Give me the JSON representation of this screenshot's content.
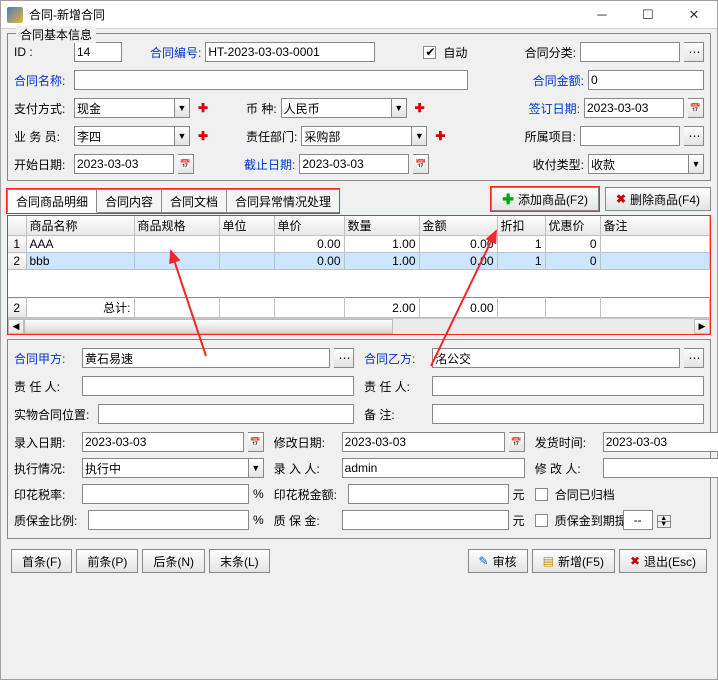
{
  "titlebar": {
    "title": "合同-新增合同"
  },
  "fieldset1": {
    "legend": "合同基本信息",
    "id_label": "ID   :",
    "id_value": "14",
    "contract_no_label": "合同编号:",
    "contract_no_value": "HT-2023-03-03-0001",
    "auto_label": "自动",
    "category_label": "合同分类:",
    "name_label": "合同名称:",
    "amount_label": "合同金额:",
    "amount_value": "0",
    "pay_method_label": "支付方式:",
    "pay_method_value": "现金",
    "currency_label": "币    种:",
    "currency_value": "人民币",
    "sign_date_label": "签订日期:",
    "sign_date_value": "2023-03-03",
    "staff_label": "业 务 员:",
    "staff_value": "李四",
    "dept_label": "责任部门:",
    "dept_value": "采购部",
    "project_label": "所属项目:",
    "start_date_label": "开始日期:",
    "start_date_value": "2023-03-03",
    "end_date_label": "截止日期:",
    "end_date_value": "2023-03-03",
    "paytype_label": "收付类型:",
    "paytype_value": "收款"
  },
  "tabs": [
    "合同商品明细",
    "合同内容",
    "合同文档",
    "合同异常情况处理"
  ],
  "toolbar": {
    "add_product": "添加商品(F2)",
    "del_product": "删除商品(F4)"
  },
  "grid": {
    "headers": [
      "商品名称",
      "商品规格",
      "单位",
      "单价",
      "数量",
      "金额",
      "折扣",
      "优惠价",
      "备注"
    ],
    "rows": [
      {
        "idx": "1",
        "name": "AAA",
        "spec": "",
        "unit": "",
        "price": "0.00",
        "qty": "1.00",
        "amount": "0.00",
        "discount": "1",
        "prefer": "0",
        "remark": ""
      },
      {
        "idx": "2",
        "name": "bbb",
        "spec": "",
        "unit": "",
        "price": "0.00",
        "qty": "1.00",
        "amount": "0.00",
        "discount": "1",
        "prefer": "0",
        "remark": ""
      }
    ],
    "footer": {
      "idx": "2",
      "label": "总计:",
      "qty": "2.00",
      "amount": "0.00"
    }
  },
  "section2": {
    "partyA_label": "合同甲方:",
    "partyA_value": "黄石易速",
    "partyB_label": "合同乙方:",
    "partyB_value": "洺公交",
    "respA_label": "责 任 人:",
    "respB_label": "责 任 人:",
    "location_label": "实物合同位置:",
    "remark_label": "备    注:",
    "entry_date_label": "录入日期:",
    "entry_date_value": "2023-03-03",
    "modify_date_label": "修改日期:",
    "modify_date_value": "2023-03-03",
    "ship_date_label": "发货时间:",
    "ship_date_value": "2023-03-03",
    "exec_label": "执行情况:",
    "exec_value": "执行中",
    "entered_by_label": "录 入 人:",
    "entered_by_value": "admin",
    "modified_by_label": "修 改 人:",
    "stamp_rate_label": "印花税率:",
    "percent": "%",
    "stamp_amount_label": "印花税金额:",
    "yuan": "元",
    "archived_label": "合同已归档",
    "deposit_rate_label": "质保金比例:",
    "deposit_label": "质 保 金:",
    "deposit_remind_label": "质保金到期提醒",
    "deposit_remind_value": "--"
  },
  "footer": {
    "first": "首条(F)",
    "prev": "前条(P)",
    "next": "后条(N)",
    "last": "末条(L)",
    "audit": "审核",
    "new": "新增(F5)",
    "exit": "退出(Esc)"
  }
}
